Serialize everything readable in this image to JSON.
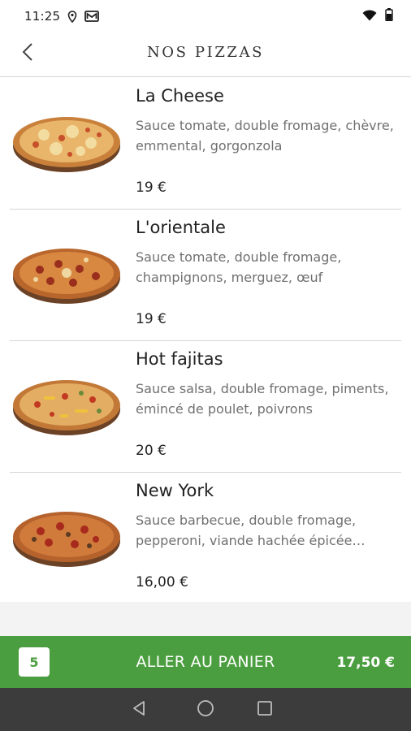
{
  "status_bar": {
    "time": "11:25",
    "icons": [
      "location-icon",
      "mail-icon",
      "wifi-icon",
      "battery-icon"
    ]
  },
  "header": {
    "title": "NOS PIZZAS",
    "back_icon": "chevron-left-icon"
  },
  "pizzas": [
    {
      "name": "La Cheese",
      "description": "Sauce tomate, double fromage, chèvre, emmental, gorgonzola",
      "price": "19 €"
    },
    {
      "name": "L'orientale",
      "description": "Sauce tomate, double fromage, champignons, merguez, œuf",
      "price": "19 €"
    },
    {
      "name": "Hot fajitas",
      "description": "Sauce salsa, double fromage, piments, émincé de poulet, poivrons",
      "price": "20 €"
    },
    {
      "name": "New York",
      "description": "Sauce barbecue, double fromage, pepperoni, viande hachée épicée…",
      "price": "16,00 €"
    }
  ],
  "cart": {
    "count": "5",
    "label": "ALLER AU PANIER",
    "total": "17,50 €"
  },
  "colors": {
    "accent_green": "#4b9e3f",
    "nav_bar": "#3c3c3c"
  },
  "nav_bar": {
    "icons": [
      "back-triangle-icon",
      "home-circle-icon",
      "recents-square-icon"
    ]
  }
}
